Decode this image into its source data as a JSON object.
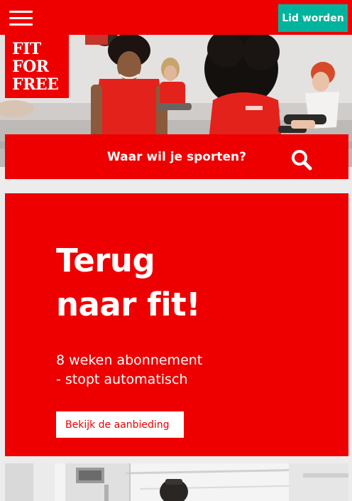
{
  "header": {
    "menu_icon": "hamburger-menu-icon",
    "join_label": "Lid worden",
    "join_color": "#00b39c",
    "brand_color": "#ee0000"
  },
  "logo": {
    "lines": [
      "FIT",
      "FOR",
      "FREE"
    ]
  },
  "hero": {
    "image": "group-fitness-class-photo"
  },
  "search": {
    "label": "Waar wil je sporten?",
    "icon": "search-icon"
  },
  "promo": {
    "title_line1": "Terug",
    "title_line2": "naar fit!",
    "subtitle_line1": "8 weken abonnement",
    "subtitle_line2": "- stopt automatisch",
    "cta_label": "Bekijk de aanbieding"
  },
  "gym_photo": {
    "image": "gym-interior-photo"
  }
}
